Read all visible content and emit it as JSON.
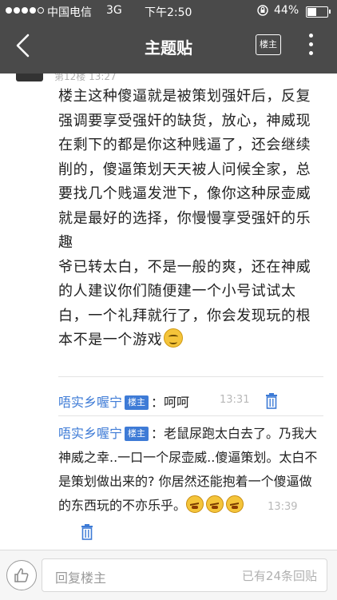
{
  "status_bar": {
    "carrier": "中国电信",
    "network": "3G",
    "time": "下午2:50",
    "battery": "44%"
  },
  "nav": {
    "title": "主题贴",
    "op_only_label": "楼主"
  },
  "floor": {
    "meta": "第12楼  13:27"
  },
  "post": {
    "paragraph1": "楼主这种傻逼就是被策划强奸后，反复强调要享受强奸的缺货，放心，神威现在剩下的都是你这种贱逼了，还会继续削的，傻逼策划天天被人问候全家，总要找几个贱逼发泄下，像你这种尿壶威就是最好的选择，你慢慢享受强奸的乐趣",
    "paragraph2": "爷已转太白，不是一般的爽，还在神威的人建议你们随便建一个小号试试太白，一个礼拜就行了，你会发现玩的根本不是一个游戏"
  },
  "replies": [
    {
      "user": "唔实乡喔宁",
      "tag": "楼主",
      "text": "：呵呵",
      "time": "13:31"
    },
    {
      "user": "唔实乡喔宁",
      "tag": "楼主",
      "text": "：老鼠尿跑太白去了。乃我大神威之幸..一口一个尿壶威..傻逼策划。太白不是策划做出来的? 你居然还能抱着一个傻逼做的东西玩的不亦乐乎。",
      "time": "13:39"
    }
  ],
  "bottom_bar": {
    "reply_placeholder": "回复楼主",
    "reply_count": "已有24条回贴"
  },
  "icons": {
    "back": "back-arrow-icon",
    "more": "more-vertical-icon",
    "trash": "trash-icon",
    "like": "thumbs-up-icon",
    "lock": "rotation-lock-icon"
  },
  "colors": {
    "nav_bg": "#4a4a4a",
    "link_blue": "#3e7bd6",
    "tag_bg": "#3e7bd6"
  }
}
